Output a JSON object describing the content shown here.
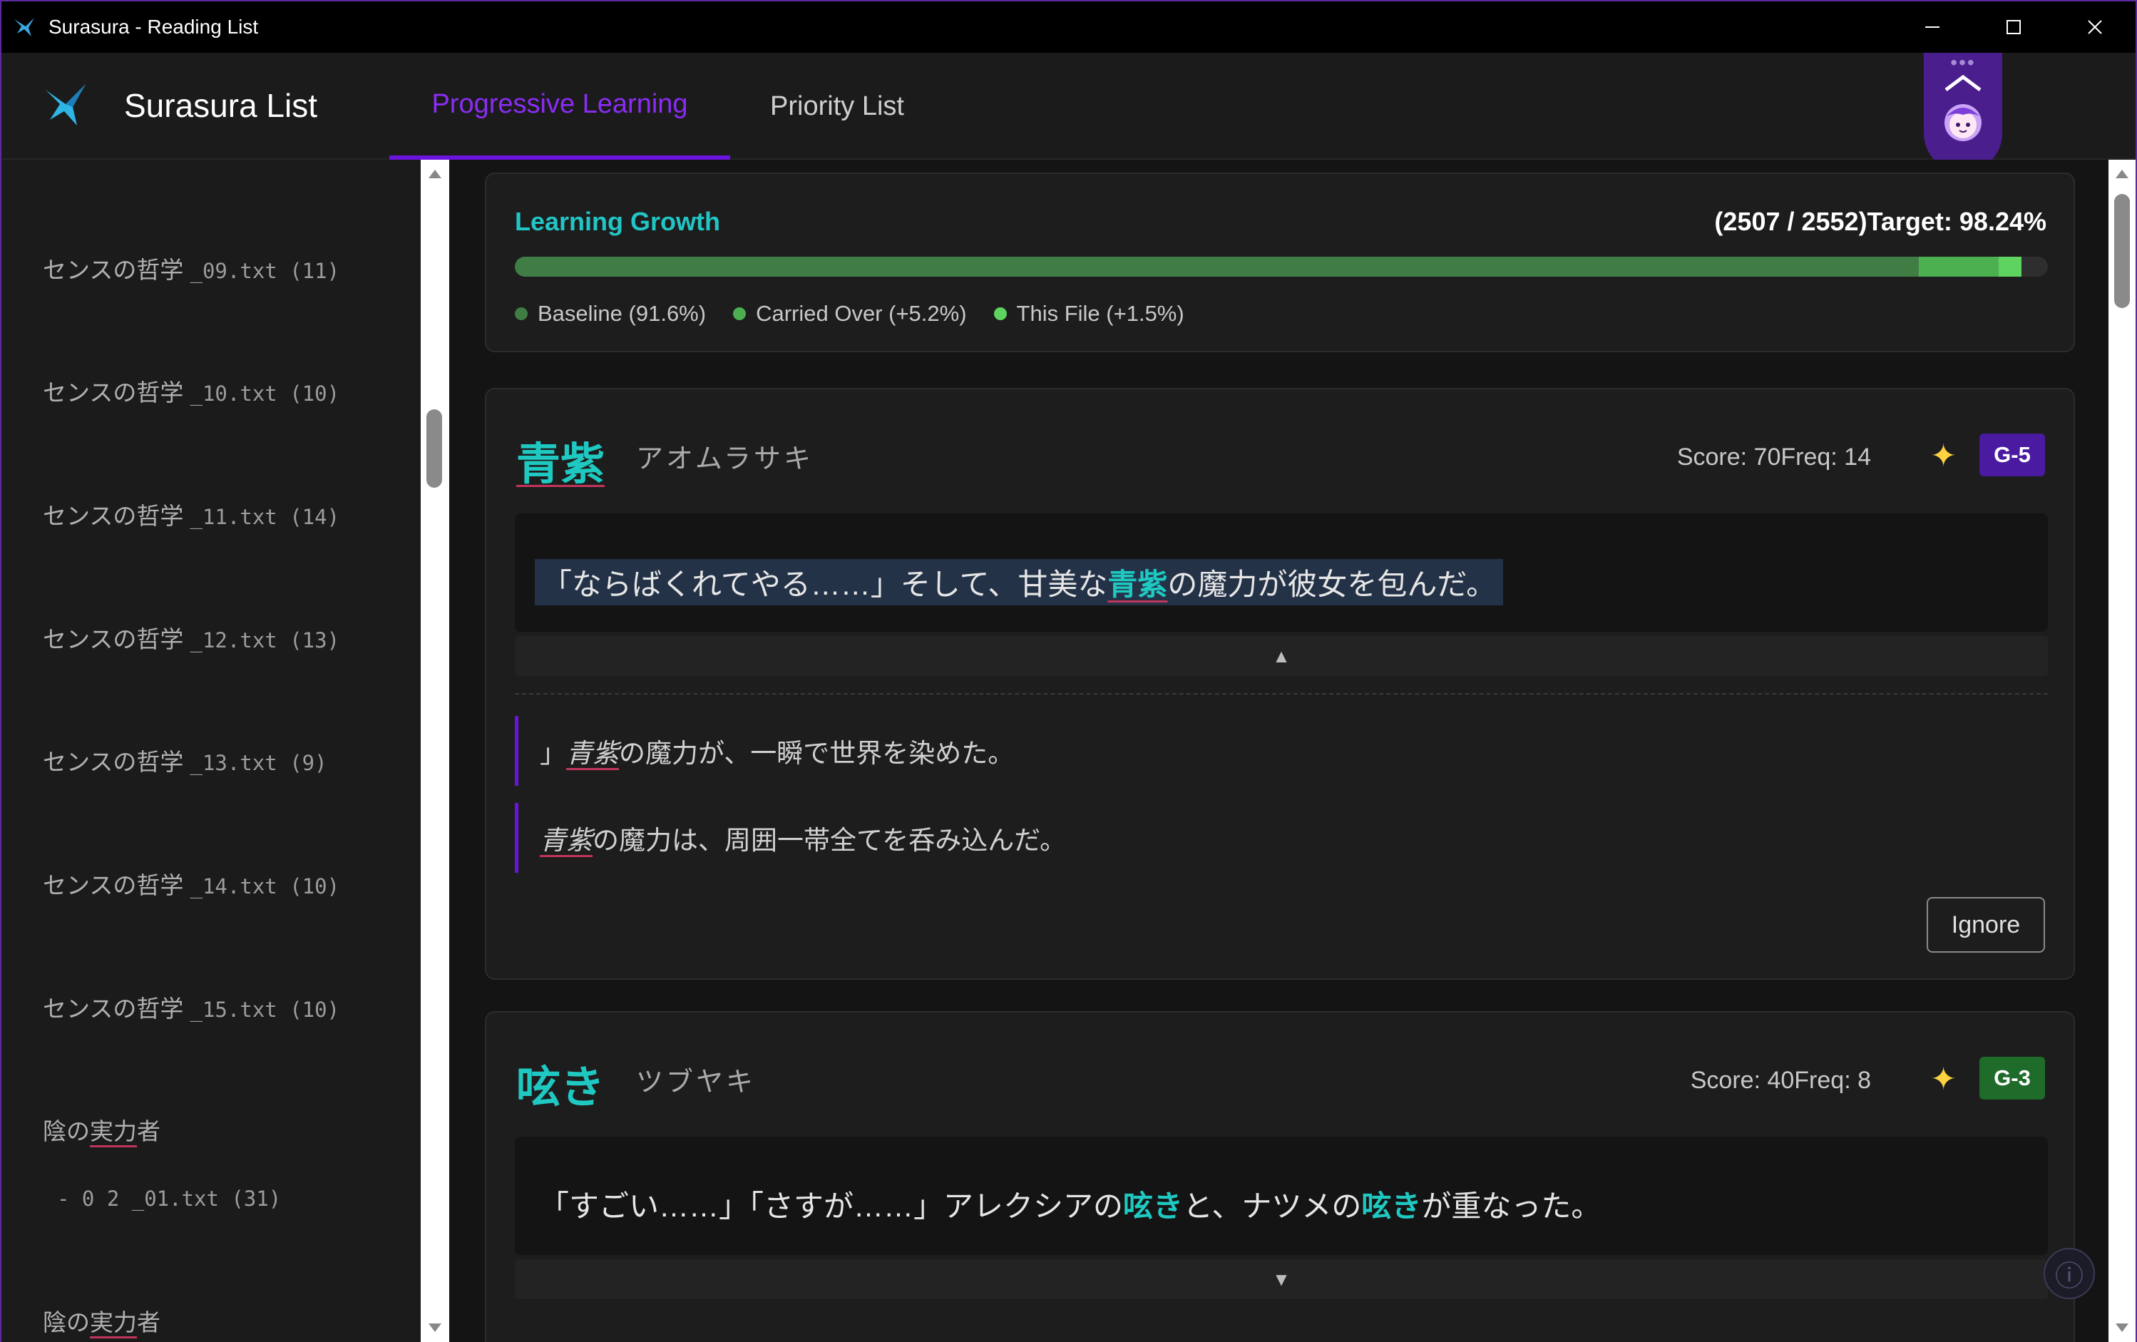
{
  "window": {
    "title": "Surasura - Reading List",
    "icon": "hummingbird-icon",
    "controls": [
      "minimize-icon",
      "maximize-icon",
      "close-icon"
    ]
  },
  "header": {
    "brand": "Surasura List",
    "tabs": [
      {
        "label": "Progressive Learning",
        "active": true
      },
      {
        "label": "Priority List",
        "active": false
      }
    ],
    "mascot_dots": "•••"
  },
  "sidebar": {
    "items": [
      {
        "title": "センスの哲学 ",
        "file": "_09.txt (11)"
      },
      {
        "title": "センスの哲学 ",
        "file": "_10.txt (10)"
      },
      {
        "title": "センスの哲学 ",
        "file": "_11.txt (14)"
      },
      {
        "title": "センスの哲学 ",
        "file": "_12.txt (13)"
      },
      {
        "title": "センスの哲学 ",
        "file": "_13.txt (9)"
      },
      {
        "title": "センスの哲学 ",
        "file": "_14.txt (10)"
      },
      {
        "title": "センスの哲学 ",
        "file": "_15.txt (10)"
      }
    ],
    "group1": {
      "title_pre": "陰の",
      "title_ul": "実力",
      "title_post": "者",
      "sub": "- 0 2 _01.txt (31)"
    },
    "group2": {
      "title_pre": "陰の",
      "title_ul": "実力",
      "title_post": "者"
    }
  },
  "growth": {
    "title": "Learning Growth",
    "target": "(2507 / 2552)Target: 98.24%",
    "baseline_pct": 91.6,
    "carried_pct": 5.2,
    "this_file_pct": 1.5,
    "legend": [
      {
        "label": "Baseline (91.6%)",
        "color": "#3f7d45"
      },
      {
        "label": "Carried Over (+5.2%)",
        "color": "#4caf50"
      },
      {
        "label": "This File (+1.5%)",
        "color": "#5fd35f"
      }
    ]
  },
  "cards": [
    {
      "word": "青紫",
      "reading": "アオムラサキ",
      "score": "Score: 70Freq: 14",
      "grade": "G-5",
      "grade_color": "#4a1aa0",
      "sentence": {
        "a": "「ならばくれてやる……」そして、甘美な",
        "hl": "青紫",
        "b": "の魔力が彼女を包んだ。"
      },
      "toggle": "▲",
      "examples": [
        {
          "pre": "」",
          "em": "青紫",
          "post": "の魔力が、一瞬で世界を染めた。"
        },
        {
          "pre": "",
          "em": "青紫",
          "post": "の魔力は、周囲一帯全てを呑み込んだ。"
        }
      ],
      "ignore": "Ignore"
    },
    {
      "word": "呟き",
      "reading": "ツブヤキ",
      "score": "Score: 40Freq: 8",
      "grade": "G-3",
      "grade_color": "#1f6b2a",
      "sentence": {
        "a": "「すごい……」「さすが……」アレクシアの",
        "hl": "呟き",
        "b": "と、ナツメの",
        "hl2": "呟き",
        "c": "が重なった。"
      },
      "toggle": "▼"
    }
  ],
  "info": "ⓘ"
}
